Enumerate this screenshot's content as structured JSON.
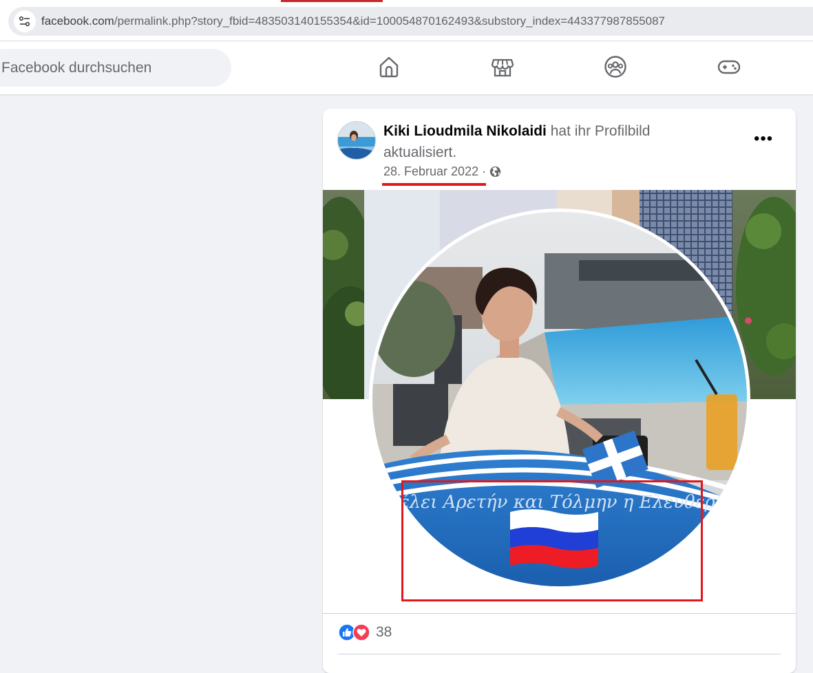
{
  "browser": {
    "url_host": "facebook.com",
    "url_path": "/permalink.php?story_fbid=483503140155354&id=100054870162493&substory_index=443377987855087",
    "site_info_icon": "tune-icon"
  },
  "header": {
    "search_placeholder": "Facebook durchsuchen",
    "nav_icons": [
      "home-icon",
      "marketplace-icon",
      "groups-icon",
      "gaming-icon"
    ]
  },
  "post": {
    "author": "Kiki Lioudmila Nikolaidi",
    "action": " hat ihr Profilbild aktualisiert.",
    "date": "28. Februar 2022",
    "separator": "·",
    "privacy_icon": "globe-icon",
    "more_label": "•••",
    "image_caption_text": "Θέλει Αρετήν και Τόλμην η Ελευθερία",
    "reactions_count": "38"
  },
  "colors": {
    "annotation_red": "#e3171b",
    "facebook_blue": "#1877f2",
    "love_red": "#f33e58"
  }
}
